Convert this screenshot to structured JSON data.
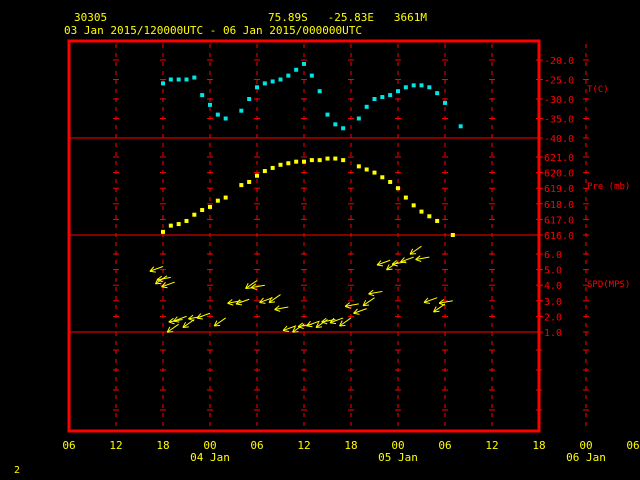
{
  "header": {
    "station": "30305",
    "location": "75.89S   -25.83E   3661M",
    "time_range": "03 Jan 2015/120000UTC - 06 Jan 2015/000000UTC"
  },
  "footer": {
    "page_number": "2"
  },
  "colors": {
    "frame": "#ff0000",
    "text": "#ffff00",
    "temperature": "#00e5e5",
    "pressure": "#ffff00",
    "wind": "#ffff00"
  },
  "chart_data": {
    "type": "scatter",
    "x_ticks": [
      "06",
      "12",
      "18",
      "00",
      "06",
      "12",
      "18",
      "00",
      "06",
      "12",
      "18",
      "00",
      "06"
    ],
    "x_date_labels": [
      "04 Jan",
      "05 Jan",
      "06 Jan"
    ],
    "panels": [
      {
        "name": "temperature",
        "ylabel": "T(C)",
        "ylim": [
          -40,
          -17.5
        ],
        "yticks": [
          "-20.0",
          "-25.0",
          "-30.0",
          "-35.0",
          "-40.0"
        ],
        "yvalues": [
          -20,
          -25,
          -30,
          -35,
          -40
        ],
        "points": [
          [
            12,
            -26
          ],
          [
            13,
            -25
          ],
          [
            14,
            -25
          ],
          [
            15,
            -25
          ],
          [
            16,
            -24.5
          ],
          [
            17,
            -29
          ],
          [
            18,
            -31.5
          ],
          [
            19,
            -34
          ],
          [
            20,
            -35
          ],
          [
            22,
            -33
          ],
          [
            23,
            -30
          ],
          [
            24,
            -27
          ],
          [
            25,
            -26
          ],
          [
            26,
            -25.5
          ],
          [
            27,
            -25
          ],
          [
            28,
            -24
          ],
          [
            29,
            -22.5
          ],
          [
            30,
            -21
          ],
          [
            31,
            -24
          ],
          [
            32,
            -28
          ],
          [
            33,
            -34
          ],
          [
            34,
            -36.5
          ],
          [
            35,
            -37.5
          ],
          [
            37,
            -35
          ],
          [
            38,
            -32
          ],
          [
            39,
            -30
          ],
          [
            40,
            -29.5
          ],
          [
            41,
            -29
          ],
          [
            42,
            -28
          ],
          [
            43,
            -27
          ],
          [
            44,
            -26.5
          ],
          [
            45,
            -26.5
          ],
          [
            46,
            -27
          ],
          [
            47,
            -28.5
          ],
          [
            48,
            -31
          ],
          [
            50,
            -37
          ]
        ]
      },
      {
        "name": "pressure",
        "ylabel": "Pre (mb)",
        "ylim": [
          616,
          621.5
        ],
        "yticks": [
          "621.0",
          "620.0",
          "619.0",
          "618.0",
          "617.0",
          "616.0"
        ],
        "yvalues": [
          621,
          620,
          619,
          618,
          617,
          616
        ],
        "points": [
          [
            12,
            616.2
          ],
          [
            13,
            616.6
          ],
          [
            14,
            616.7
          ],
          [
            15,
            616.9
          ],
          [
            16,
            617.3
          ],
          [
            17,
            617.6
          ],
          [
            18,
            617.8
          ],
          [
            19,
            618.2
          ],
          [
            20,
            618.4
          ],
          [
            22,
            619.2
          ],
          [
            23,
            619.4
          ],
          [
            24,
            619.8
          ],
          [
            25,
            620.1
          ],
          [
            26,
            620.3
          ],
          [
            27,
            620.5
          ],
          [
            28,
            620.6
          ],
          [
            29,
            620.7
          ],
          [
            30,
            620.7
          ],
          [
            31,
            620.8
          ],
          [
            32,
            620.8
          ],
          [
            33,
            620.9
          ],
          [
            34,
            620.9
          ],
          [
            35,
            620.8
          ],
          [
            37,
            620.4
          ],
          [
            38,
            620.2
          ],
          [
            39,
            620.0
          ],
          [
            40,
            619.7
          ],
          [
            41,
            619.4
          ],
          [
            42,
            619.0
          ],
          [
            43,
            618.4
          ],
          [
            44,
            617.9
          ],
          [
            45,
            617.5
          ],
          [
            46,
            617.2
          ],
          [
            47,
            616.9
          ],
          [
            49,
            616.0
          ]
        ]
      },
      {
        "name": "wind",
        "ylabel": "SPD(MPS)",
        "ylim": [
          0.5,
          7
        ],
        "yticks": [
          "6.0",
          "5.0",
          "4.0",
          "3.0",
          "2.0",
          "1.0"
        ],
        "yvalues": [
          6,
          5,
          4,
          3,
          2,
          1
        ],
        "points": [
          [
            12,
            5.2
          ],
          [
            12.5,
            4.6
          ],
          [
            13,
            4.5
          ],
          [
            13.5,
            4.2
          ],
          [
            14,
            1.5
          ],
          [
            14.5,
            1.8
          ],
          [
            15,
            2.0
          ],
          [
            16,
            1.8
          ],
          [
            17,
            2.0
          ],
          [
            18,
            2.2
          ],
          [
            20,
            1.9
          ],
          [
            22,
            3.0
          ],
          [
            23,
            3.1
          ],
          [
            24,
            4.3
          ],
          [
            25,
            4.0
          ],
          [
            26,
            3.2
          ],
          [
            27,
            3.4
          ],
          [
            28,
            2.6
          ],
          [
            29,
            1.4
          ],
          [
            30,
            1.5
          ],
          [
            31,
            1.5
          ],
          [
            32,
            1.7
          ],
          [
            33,
            1.8
          ],
          [
            34,
            1.8
          ],
          [
            35,
            1.9
          ],
          [
            36,
            1.9
          ],
          [
            37,
            2.8
          ],
          [
            38,
            2.5
          ],
          [
            39,
            3.2
          ],
          [
            40,
            3.6
          ],
          [
            41,
            5.6
          ],
          [
            42,
            5.5
          ],
          [
            43,
            5.5
          ],
          [
            44,
            5.8
          ],
          [
            45,
            6.5
          ],
          [
            46,
            5.8
          ],
          [
            47,
            3.2
          ],
          [
            48,
            2.8
          ],
          [
            49,
            3.0
          ]
        ]
      }
    ]
  }
}
